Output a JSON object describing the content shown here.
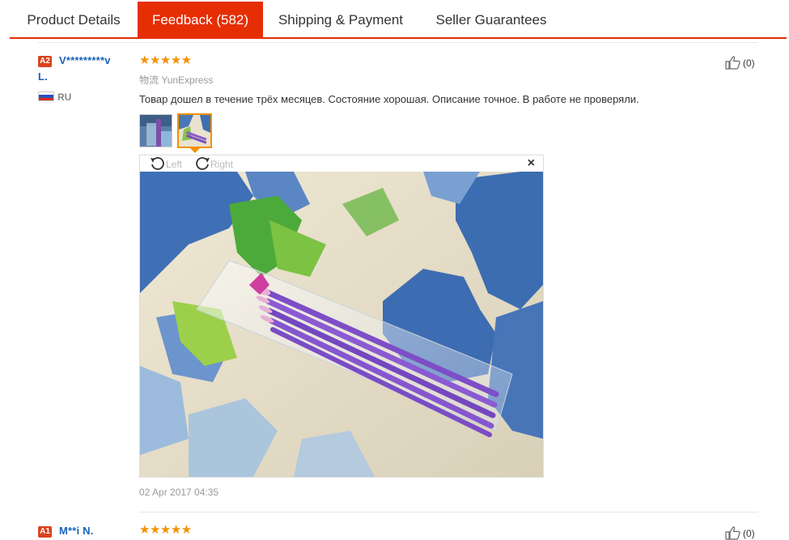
{
  "tabs": [
    {
      "label": "Product Details"
    },
    {
      "label": "Feedback (582)"
    },
    {
      "label": "Shipping & Payment"
    },
    {
      "label": "Seller Guarantees"
    }
  ],
  "reviews": [
    {
      "level": "A2",
      "user_line1": "V*********v",
      "user_line2": "L.",
      "country": "RU",
      "rating": "★★★★★",
      "logistics_label": "物流",
      "logistics_value": "YunExpress",
      "comment": "Товар дошел в течение трёх месяцев. Состояние хорошая. Описание точное. В работе не проверяли.",
      "likes": "(0)",
      "viewer": {
        "left_label": "Left",
        "right_label": "Right",
        "close": "×"
      },
      "date": "02 Apr 2017 04:35"
    },
    {
      "level": "A1",
      "user_line1": "M**i N.",
      "rating": "★★★★★",
      "likes": "(0)"
    }
  ],
  "colors": {
    "accent": "#e62e04",
    "star": "#f29100",
    "link": "#1a63b5"
  }
}
